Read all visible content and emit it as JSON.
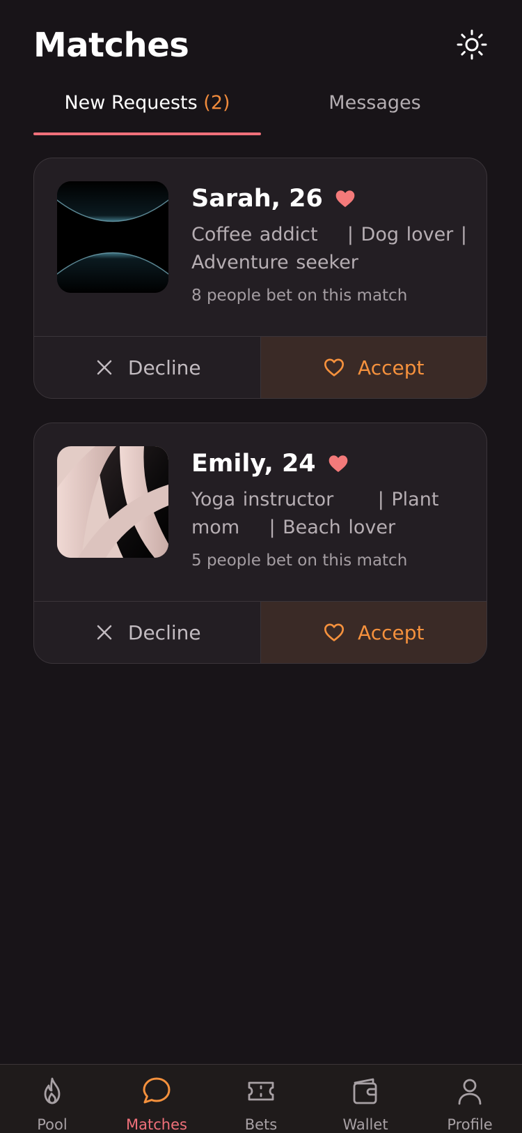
{
  "header": {
    "title": "Matches",
    "theme_icon": "sun-icon"
  },
  "tabs": {
    "requests_label": "New Requests",
    "requests_count": "(2)",
    "messages_label": "Messages"
  },
  "matches": [
    {
      "name": "Sarah, 26",
      "bio": "Coffee addict    | Dog lover | Adventure seeker",
      "bets": "8 people bet on this match",
      "decline_label": "Decline",
      "accept_label": "Accept"
    },
    {
      "name": "Emily, 24",
      "bio": "Yoga instructor      | Plant mom    | Beach lover",
      "bets": "5 people bet on this match",
      "decline_label": "Decline",
      "accept_label": "Accept"
    }
  ],
  "nav": {
    "pool": "Pool",
    "matches": "Matches",
    "bets": "Bets",
    "wallet": "Wallet",
    "profile": "Profile"
  },
  "colors": {
    "background": "#181418",
    "card": "#231e23",
    "accent_orange": "#f5913d",
    "accent_pink": "#f0707a"
  }
}
